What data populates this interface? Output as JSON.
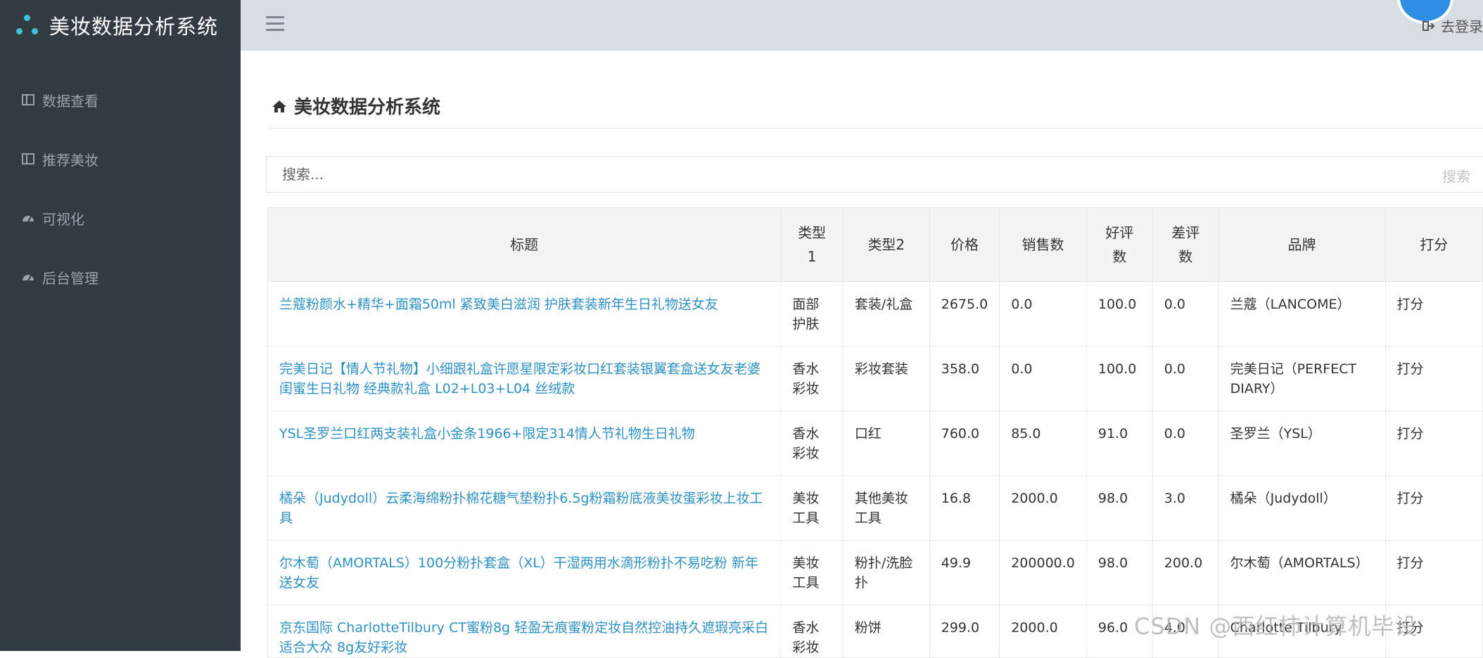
{
  "app": {
    "title": "美妆数据分析系统"
  },
  "sidebar": {
    "items": [
      {
        "label": "数据查看",
        "icon": "table-icon"
      },
      {
        "label": "推荐美妆",
        "icon": "table-icon"
      },
      {
        "label": "可视化",
        "icon": "dashboard-icon"
      },
      {
        "label": "后台管理",
        "icon": "dashboard-icon"
      }
    ]
  },
  "header": {
    "logout_label": "去登录"
  },
  "page": {
    "title": "美妆数据分析系统"
  },
  "search": {
    "placeholder": "搜索...",
    "button_label": "搜索"
  },
  "table": {
    "headers": [
      "标题",
      "类型1",
      "类型2",
      "价格",
      "销售数",
      "好评数",
      "差评数",
      "品牌",
      "打分"
    ],
    "rows": [
      [
        "兰蔻粉颜水+精华+面霜50ml 紧致美白滋润 护肤套装新年生日礼物送女友",
        "面部护肤",
        "套装/礼盒",
        "2675.0",
        "0.0",
        "100.0",
        "0.0",
        "兰蔻（LANCOME）",
        "打分"
      ],
      [
        "完美日记【情人节礼物】小细跟礼盒许愿星限定彩妆口红套装银翼套盒送女友老婆闺蜜生日礼物 经典款礼盒 L02+L03+L04 丝绒款",
        "香水彩妆",
        "彩妆套装",
        "358.0",
        "0.0",
        "100.0",
        "0.0",
        "完美日记（PERFECT DIARY）",
        "打分"
      ],
      [
        "YSL圣罗兰口红两支装礼盒小金条1966+限定314情人节礼物生日礼物",
        "香水彩妆",
        "口红",
        "760.0",
        "85.0",
        "91.0",
        "0.0",
        "圣罗兰（YSL）",
        "打分"
      ],
      [
        "橘朵（Judydoll）云柔海绵粉扑棉花糖气垫粉扑6.5g粉霜粉底液美妆蛋彩妆上妆工具",
        "美妆工具",
        "其他美妆工具",
        "16.8",
        "2000.0",
        "98.0",
        "3.0",
        "橘朵（Judydoll）",
        "打分"
      ],
      [
        "尔木萄（AMORTALS）100分粉扑套盒（XL）干湿两用水滴形粉扑不易吃粉 新年送女友",
        "美妆工具",
        "粉扑/洗脸扑",
        "49.9",
        "200000.0",
        "98.0",
        "200.0",
        "尔木萄（AMORTALS）",
        "打分"
      ],
      [
        "京东国际 CharlotteTilbury CT蜜粉8g 轻盈无痕蜜粉定妆自然控油持久遮瑕亮采白适合大众 8g友好彩妆",
        "香水彩妆",
        "粉饼",
        "299.0",
        "2000.0",
        "96.0",
        "4.0",
        "Charlotte Tilbury",
        "打分"
      ]
    ]
  },
  "watermark": "CSDN @西红柿计算机毕设",
  "colors": {
    "sidebar_bg": "#323b44",
    "topbar_bg": "#d7dde3",
    "link": "#2e91c4",
    "brand_accent": "#3fc3d5"
  }
}
